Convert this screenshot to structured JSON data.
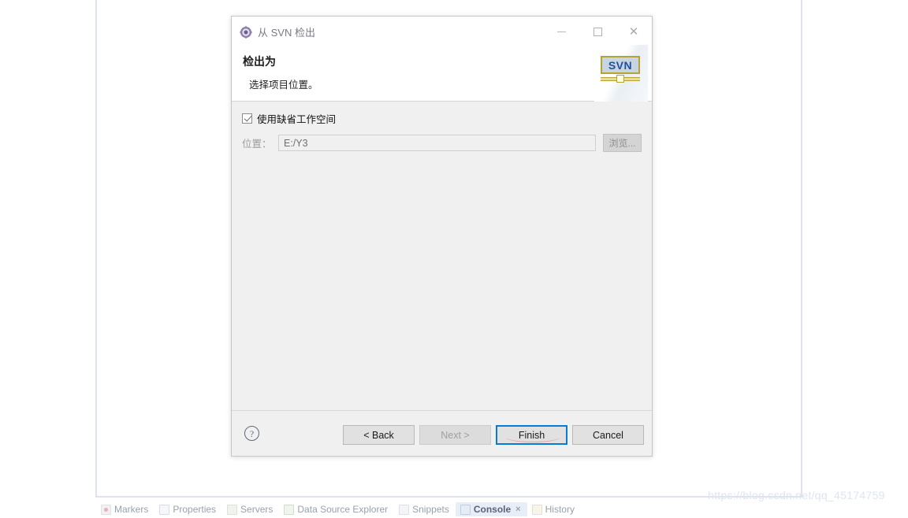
{
  "workbench": {
    "view_tabs": [
      {
        "label": "Markers",
        "icon": "markers-icon",
        "active": false,
        "closable": false
      },
      {
        "label": "Properties",
        "icon": "properties-icon",
        "active": false,
        "closable": false
      },
      {
        "label": "Servers",
        "icon": "servers-icon",
        "active": false,
        "closable": false
      },
      {
        "label": "Data Source Explorer",
        "icon": "data-source-explorer-icon",
        "active": false,
        "closable": false
      },
      {
        "label": "Snippets",
        "icon": "snippets-icon",
        "active": false,
        "closable": false
      },
      {
        "label": "Console",
        "icon": "console-icon",
        "active": true,
        "closable": true
      },
      {
        "label": "History",
        "icon": "history-icon",
        "active": false,
        "closable": false
      }
    ],
    "watermark": "https://blog.csdn.net/qq_45174759"
  },
  "dialog": {
    "title": "从 SVN 检出",
    "title_icon": "svn-repository-icon",
    "window_controls": {
      "minimize": "minimize-icon",
      "maximize": "maximize-icon",
      "close": "close-icon"
    },
    "banner": {
      "heading": "检出为",
      "description": "选择项目位置。",
      "logo_text": "SVN"
    },
    "form": {
      "use_default_workspace": {
        "label": "使用缺省工作空间",
        "checked": true
      },
      "location": {
        "label": "位置：",
        "value": "E:/Y3",
        "placeholder": "",
        "disabled": true
      },
      "browse_button": {
        "label": "浏览...",
        "disabled": true
      }
    },
    "footer": {
      "help_glyph": "?",
      "buttons": [
        {
          "label": "< Back",
          "state": "enabled",
          "name": "back-button"
        },
        {
          "label": "Next >",
          "state": "disabled",
          "name": "next-button"
        },
        {
          "label": "Finish",
          "state": "default-focused",
          "name": "finish-button"
        },
        {
          "label": "Cancel",
          "state": "enabled",
          "name": "cancel-button"
        }
      ]
    }
  },
  "colors": {
    "focus_ring": "#0a7bd4",
    "annotation": "#e79aa6",
    "dialog_background": "#f0f0f0",
    "banner_background": "#ffffff",
    "svn_blue": "#1f4f9e",
    "svn_gold": "#b5a431"
  }
}
